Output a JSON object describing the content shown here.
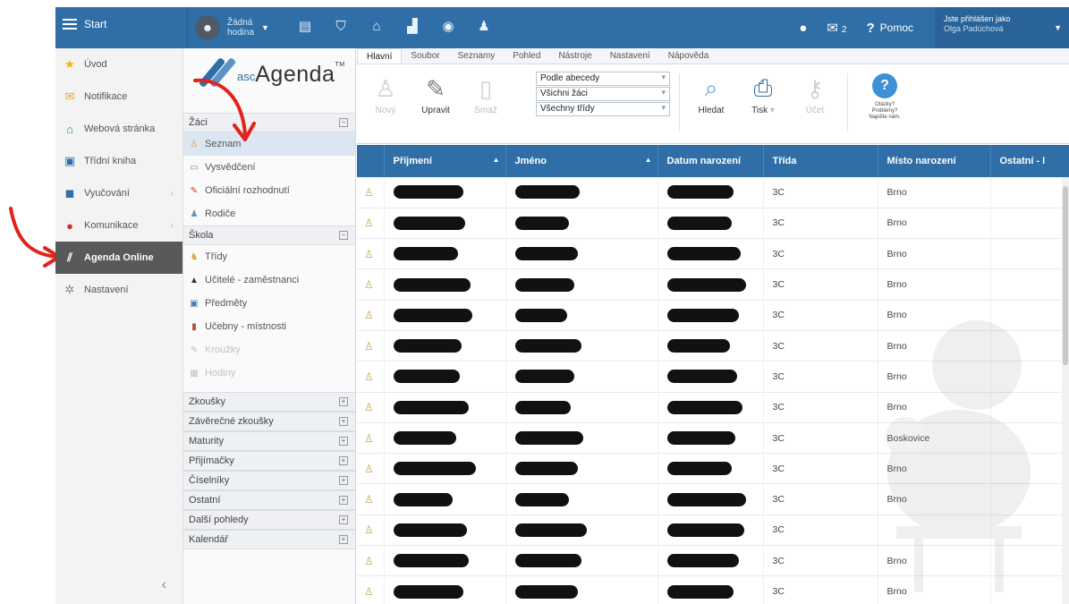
{
  "topbar": {
    "start_label": "Start",
    "hour_line1": "Žádná",
    "hour_line2": "hodina",
    "mail_count": "2",
    "help_label": "Pomoc",
    "user_line1": "Jste přihlášen jako",
    "user_line2": "Olga Padúchová"
  },
  "leftnav": {
    "items": [
      {
        "label": "Úvod",
        "icon": "star-icon"
      },
      {
        "label": "Notifikace",
        "icon": "envelope-icon"
      },
      {
        "label": "Webová stránka",
        "icon": "house-icon"
      },
      {
        "label": "Třídní kniha",
        "icon": "book-icon"
      },
      {
        "label": "Vyučování",
        "icon": "briefcase-icon"
      },
      {
        "label": "Komunikace",
        "icon": "chat-icon"
      },
      {
        "label": "Agenda Online",
        "icon": "agenda-icon"
      },
      {
        "label": "Nastavení",
        "icon": "gear-icon"
      }
    ],
    "collapse": "‹"
  },
  "module": {
    "logo_asc": "asc",
    "logo_name": "Agenda",
    "logo_tm": "TM",
    "zaci_title": "Žáci",
    "zaci_items": [
      "Seznam",
      "Vysvědčení",
      "Oficiální rozhodnutí",
      "Rodiče"
    ],
    "skola_title": "Škola",
    "skola_items": [
      "Třídy",
      "Učitelé - zaměstnanci",
      "Předměty",
      "Učebny - místnosti",
      "Kroužky",
      "Hodiny"
    ],
    "collapsed_sections": [
      "Zkoušky",
      "Závěrečné zkoušky",
      "Maturity",
      "Přijímačky",
      "Číselníky",
      "Ostatní",
      "Další pohledy",
      "Kalendář"
    ]
  },
  "ribbon": {
    "tabs": [
      "Hlavní",
      "Soubor",
      "Seznamy",
      "Pohled",
      "Nástroje",
      "Nastavení",
      "Nápověda"
    ],
    "btn_new": "Nový",
    "btn_edit": "Upravit",
    "btn_delete": "Smaž",
    "select_sort": "Podle abecedy",
    "select_students": "Všichni žáci",
    "select_classes": "Všechny třídy",
    "btn_search": "Hledat",
    "btn_print": "Tisk",
    "btn_account": "Účet",
    "help_line1": "Otázky?",
    "help_line2": "Problémy?",
    "help_line3": "Napište nám."
  },
  "table": {
    "headers": [
      "Příjmení",
      "Jméno",
      "Datum narození",
      "Třída",
      "Místo narození",
      "Ostatní - I"
    ],
    "rows": [
      {
        "trida": "3C",
        "misto": "Brno"
      },
      {
        "trida": "3C",
        "misto": "Brno"
      },
      {
        "trida": "3C",
        "misto": "Brno"
      },
      {
        "trida": "3C",
        "misto": "Brno"
      },
      {
        "trida": "3C",
        "misto": "Brno"
      },
      {
        "trida": "3C",
        "misto": "Brno"
      },
      {
        "trida": "3C",
        "misto": "Brno"
      },
      {
        "trida": "3C",
        "misto": "Brno"
      },
      {
        "trida": "3C",
        "misto": "Boskovice"
      },
      {
        "trida": "3C",
        "misto": "Brno"
      },
      {
        "trida": "3C",
        "misto": "Brno"
      },
      {
        "trida": "3C",
        "misto": ""
      },
      {
        "trida": "3C",
        "misto": "Brno"
      },
      {
        "trida": "3C",
        "misto": "Brno"
      }
    ]
  },
  "colors": {
    "primary": "#2f6ea6",
    "nav_active": "#595959",
    "annotation_arrow": "#e0231b"
  }
}
